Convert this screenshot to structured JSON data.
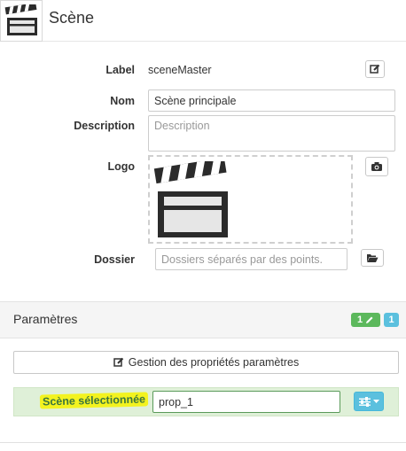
{
  "header": {
    "title": "Scène",
    "icon": "clapperboard-icon"
  },
  "form": {
    "label": {
      "label": "Label",
      "value": "sceneMaster"
    },
    "nom": {
      "label": "Nom",
      "value": "Scène principale"
    },
    "description": {
      "label": "Description",
      "placeholder": "Description"
    },
    "logo": {
      "label": "Logo",
      "icon": "clapperboard-icon"
    },
    "dossier": {
      "label": "Dossier",
      "placeholder": "Dossiers séparés par des points."
    }
  },
  "parametres": {
    "title": "Paramètres",
    "badge_edit_count": "1",
    "badge_count": "1",
    "manage_button_label": "Gestion des propriétés paramètres",
    "selected_label": "Scène sélectionnée",
    "selected_value": "prop_1"
  },
  "colors": {
    "success": "#5cb85c",
    "info": "#5bc0de",
    "highlight": "#f3f31f"
  }
}
